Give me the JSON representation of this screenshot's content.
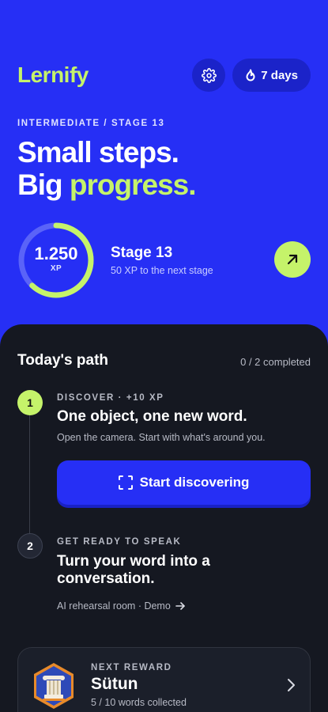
{
  "header": {
    "logo": "Lernify",
    "streak_label": "7 days"
  },
  "hero": {
    "kicker": "INTERMEDIATE / STAGE 13",
    "headline_line1": "Small steps.",
    "headline_word": "Big",
    "headline_accent": "progress."
  },
  "progress": {
    "xp_value": "1.250",
    "xp_unit": "XP",
    "ring_fraction": 0.62,
    "stage_title": "Stage 13",
    "stage_sub": "50 XP to the next stage"
  },
  "path": {
    "title": "Today's path",
    "count": "0 / 2 completed",
    "steps": [
      {
        "number": "1",
        "kicker": "DISCOVER · +10 XP",
        "title": "One object, one new word.",
        "desc": "Open the camera. Start with what's around you.",
        "cta_label": "Start discovering"
      },
      {
        "number": "2",
        "kicker": "GET READY TO SPEAK",
        "title": "Turn your word into a conversation.",
        "link_label": "AI rehearsal room · Demo"
      }
    ]
  },
  "reward": {
    "kicker": "NEXT REWARD",
    "title": "Sütun",
    "sub": "5 / 10 words collected"
  },
  "colors": {
    "brand_blue": "#262ff5",
    "accent_lime": "#c5f36a",
    "sheet_dark": "#151821"
  },
  "icons": {
    "settings": "gear-icon",
    "streak": "flame-icon",
    "go": "arrow-up-right-icon",
    "scan": "scan-frame-icon",
    "link": "arrow-right-icon",
    "reward": "column-badge-icon",
    "open": "chevron-right-icon"
  }
}
